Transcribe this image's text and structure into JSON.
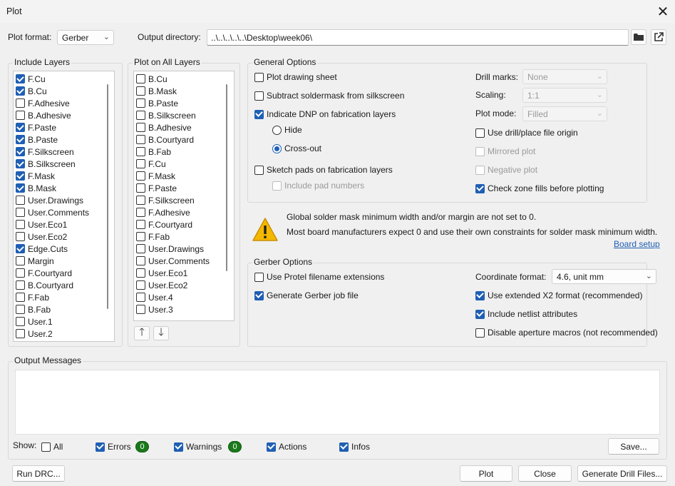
{
  "window": {
    "title": "Plot"
  },
  "top": {
    "plot_format_label": "Plot format:",
    "plot_format_value": "Gerber",
    "output_dir_label": "Output directory:",
    "output_dir_value": "..\\..\\..\\..\\..\\Desktop\\week06\\"
  },
  "include_layers": {
    "title": "Include Layers",
    "items": [
      {
        "label": "F.Cu",
        "checked": true
      },
      {
        "label": "B.Cu",
        "checked": true
      },
      {
        "label": "F.Adhesive",
        "checked": false
      },
      {
        "label": "B.Adhesive",
        "checked": false
      },
      {
        "label": "F.Paste",
        "checked": true
      },
      {
        "label": "B.Paste",
        "checked": true
      },
      {
        "label": "F.Silkscreen",
        "checked": true
      },
      {
        "label": "B.Silkscreen",
        "checked": true
      },
      {
        "label": "F.Mask",
        "checked": true
      },
      {
        "label": "B.Mask",
        "checked": true
      },
      {
        "label": "User.Drawings",
        "checked": false
      },
      {
        "label": "User.Comments",
        "checked": false
      },
      {
        "label": "User.Eco1",
        "checked": false
      },
      {
        "label": "User.Eco2",
        "checked": false
      },
      {
        "label": "Edge.Cuts",
        "checked": true
      },
      {
        "label": "Margin",
        "checked": false
      },
      {
        "label": "F.Courtyard",
        "checked": false
      },
      {
        "label": "B.Courtyard",
        "checked": false
      },
      {
        "label": "F.Fab",
        "checked": false
      },
      {
        "label": "B.Fab",
        "checked": false
      },
      {
        "label": "User.1",
        "checked": false
      },
      {
        "label": "User.2",
        "checked": false
      }
    ]
  },
  "plot_all_layers": {
    "title": "Plot on All Layers",
    "items": [
      {
        "label": "B.Cu",
        "checked": false
      },
      {
        "label": "B.Mask",
        "checked": false
      },
      {
        "label": "B.Paste",
        "checked": false
      },
      {
        "label": "B.Silkscreen",
        "checked": false
      },
      {
        "label": "B.Adhesive",
        "checked": false
      },
      {
        "label": "B.Courtyard",
        "checked": false
      },
      {
        "label": "B.Fab",
        "checked": false
      },
      {
        "label": "F.Cu",
        "checked": false
      },
      {
        "label": "F.Mask",
        "checked": false
      },
      {
        "label": "F.Paste",
        "checked": false
      },
      {
        "label": "F.Silkscreen",
        "checked": false
      },
      {
        "label": "F.Adhesive",
        "checked": false
      },
      {
        "label": "F.Courtyard",
        "checked": false
      },
      {
        "label": "F.Fab",
        "checked": false
      },
      {
        "label": "User.Drawings",
        "checked": false
      },
      {
        "label": "User.Comments",
        "checked": false
      },
      {
        "label": "User.Eco1",
        "checked": false
      },
      {
        "label": "User.Eco2",
        "checked": false
      },
      {
        "label": "User.4",
        "checked": false
      },
      {
        "label": "User.3",
        "checked": false
      }
    ]
  },
  "general": {
    "title": "General Options",
    "plot_drawing_sheet": {
      "label": "Plot drawing sheet",
      "checked": false
    },
    "subtract_soldermask": {
      "label": "Subtract soldermask from silkscreen",
      "checked": false
    },
    "indicate_dnp": {
      "label": "Indicate DNP on fabrication layers",
      "checked": true
    },
    "hide": {
      "label": "Hide",
      "checked": false
    },
    "cross_out": {
      "label": "Cross-out",
      "checked": true
    },
    "sketch_pads": {
      "label": "Sketch pads on fabrication layers",
      "checked": false
    },
    "include_pad_numbers": {
      "label": "Include pad numbers",
      "checked": false
    },
    "drill_marks_label": "Drill marks:",
    "drill_marks_value": "None",
    "scaling_label": "Scaling:",
    "scaling_value": "1:1",
    "plot_mode_label": "Plot mode:",
    "plot_mode_value": "Filled",
    "use_drill_origin": {
      "label": "Use drill/place file origin",
      "checked": false
    },
    "mirrored_plot": {
      "label": "Mirrored plot",
      "checked": false
    },
    "negative_plot": {
      "label": "Negative plot",
      "checked": false
    },
    "check_zone_fills": {
      "label": "Check zone fills before plotting",
      "checked": true
    }
  },
  "warning": {
    "line1": "Global solder mask minimum width and/or margin are not set to 0.",
    "line2": "Most board manufacturers expect 0 and use their own constraints for solder mask minimum width.",
    "link": "Board setup",
    "icon_color": "#f5b800"
  },
  "gerber": {
    "title": "Gerber Options",
    "protel": {
      "label": "Use Protel filename extensions",
      "checked": false
    },
    "job_file": {
      "label": "Generate Gerber job file",
      "checked": true
    },
    "coord_label": "Coordinate format:",
    "coord_value": "4.6, unit mm",
    "x2": {
      "label": "Use extended X2 format (recommended)",
      "checked": true
    },
    "netlist": {
      "label": "Include netlist attributes",
      "checked": true
    },
    "aperture": {
      "label": "Disable aperture macros (not recommended)",
      "checked": false
    }
  },
  "output": {
    "title": "Output Messages",
    "show_label": "Show:",
    "filters": {
      "all": {
        "label": "All",
        "checked": false
      },
      "errors": {
        "label": "Errors",
        "checked": true,
        "count": "0"
      },
      "warnings": {
        "label": "Warnings",
        "checked": true,
        "count": "0"
      },
      "actions": {
        "label": "Actions",
        "checked": true
      },
      "infos": {
        "label": "Infos",
        "checked": true
      }
    },
    "save_label": "Save..."
  },
  "footer": {
    "run_drc": "Run DRC...",
    "plot": "Plot",
    "close": "Close",
    "generate_drill": "Generate Drill Files..."
  },
  "colors": {
    "accent": "#1f5fb4",
    "badge": "#1a7a1a"
  }
}
